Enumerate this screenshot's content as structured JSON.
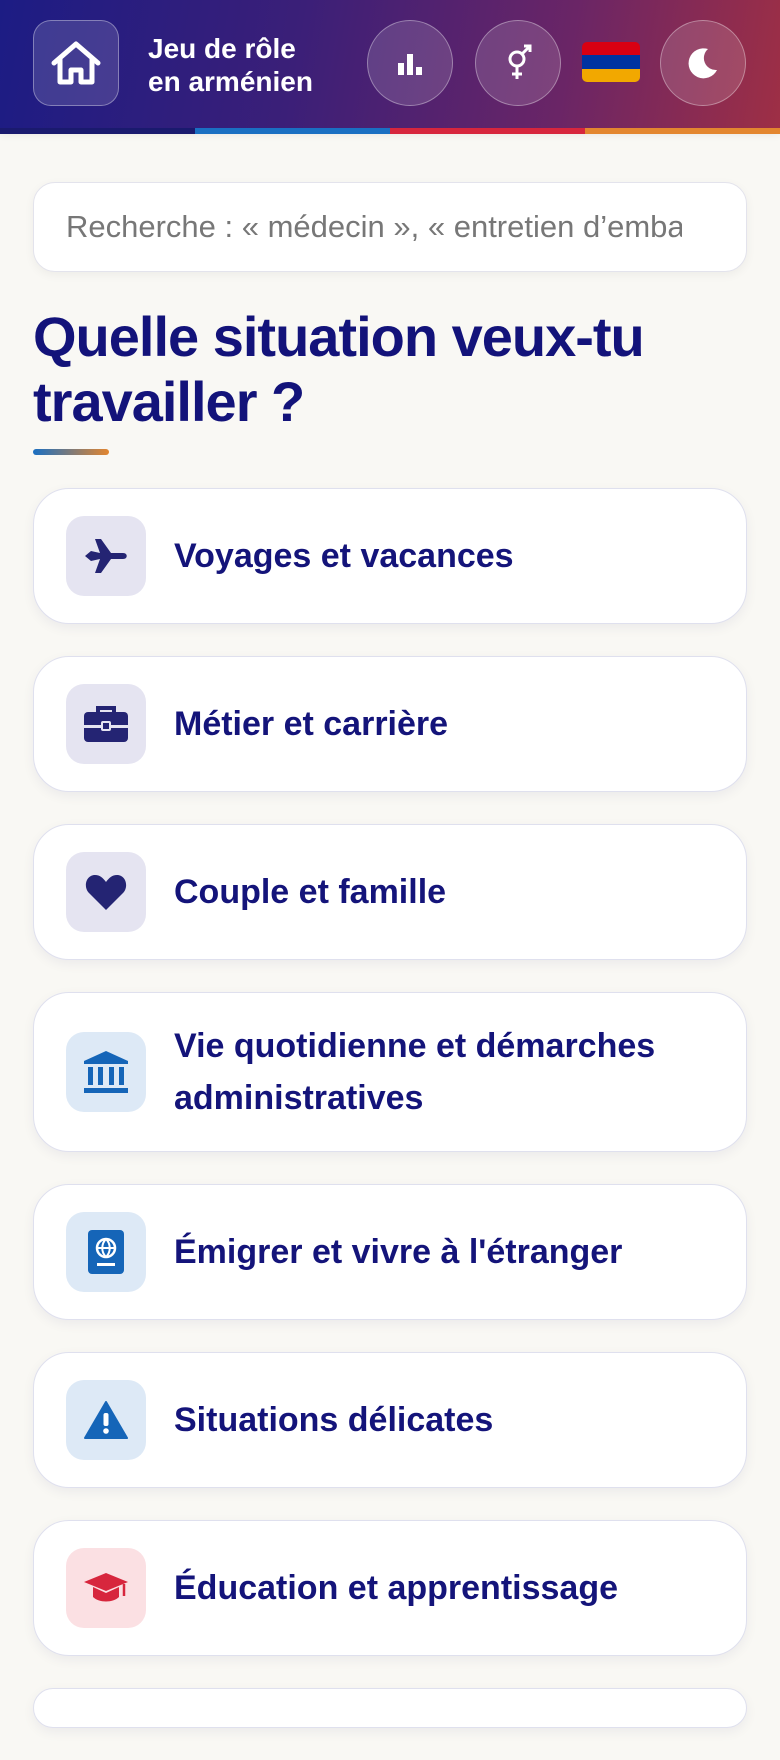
{
  "header": {
    "title_line1": "Jeu de rôle",
    "title_line2": "en arménien",
    "icons": [
      "home-icon",
      "stats-icon",
      "gender-icon",
      "armenian-flag",
      "moon-icon"
    ],
    "flag_colors": [
      "#d90012",
      "#0033a0",
      "#f2a800"
    ],
    "stripe_colors": [
      "#1a1a6e",
      "#1a6fc2",
      "#d7263d",
      "#e3862f"
    ]
  },
  "search": {
    "placeholder": "Recherche : « médecin », « entretien d’embauche »",
    "value": ""
  },
  "main": {
    "heading": "Quelle situation veux-tu travailler ?",
    "categories": [
      {
        "label": "Voyages et vacances",
        "icon": "plane-icon",
        "icon_color": "#242473",
        "tile_color": "#e5e4f1"
      },
      {
        "label": "Métier et carrière",
        "icon": "briefcase-icon",
        "icon_color": "#242473",
        "tile_color": "#e5e4f1"
      },
      {
        "label": "Couple et famille",
        "icon": "heart-icon",
        "icon_color": "#242473",
        "tile_color": "#e5e4f1"
      },
      {
        "label": "Vie quotidienne et démarches administratives",
        "icon": "bank-icon",
        "icon_color": "#1565b8",
        "tile_color": "#dde9f6"
      },
      {
        "label": "Émigrer et vivre à l'étranger",
        "icon": "passport-icon",
        "icon_color": "#1565b8",
        "tile_color": "#dde9f6"
      },
      {
        "label": "Situations délicates",
        "icon": "warning-icon",
        "icon_color": "#1565b8",
        "tile_color": "#dde9f6"
      },
      {
        "label": "Éducation et apprentissage",
        "icon": "graduation-cap-icon",
        "icon_color": "#d7263d",
        "tile_color": "#fbe0e3"
      }
    ]
  }
}
